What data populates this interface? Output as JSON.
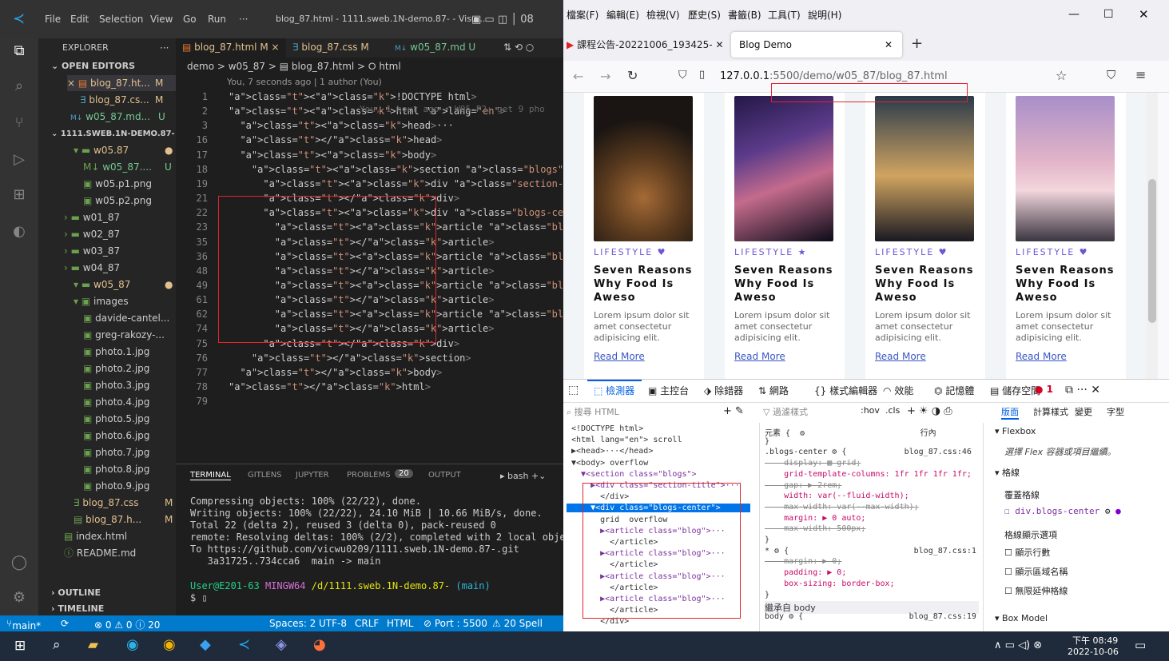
{
  "vscode": {
    "title": "blog_87.html - 1111.sweb.1N-demo.87- - Visu...",
    "menu": [
      "File",
      "Edit",
      "Selection",
      "View",
      "Go",
      "Run",
      "···"
    ],
    "explorer_label": "EXPLORER",
    "open_editors_label": "OPEN EDITORS",
    "open_editors": [
      {
        "name": "blog_87.ht...",
        "status": "M"
      },
      {
        "name": "blog_87.cs...",
        "status": "M"
      },
      {
        "name": "w05_87.md...",
        "status": "U"
      }
    ],
    "repo_label": "1111.SWEB.1N-DEMO.87-",
    "tree": [
      {
        "name": "w05.87",
        "status": "●"
      },
      {
        "name": "w05_87....",
        "status": "U"
      },
      {
        "name": "w05.p1.png",
        "status": ""
      },
      {
        "name": "w05.p2.png",
        "status": ""
      },
      {
        "name": "w01_87",
        "status": ""
      },
      {
        "name": "w02_87",
        "status": ""
      },
      {
        "name": "w03_87",
        "status": ""
      },
      {
        "name": "w04_87",
        "status": ""
      },
      {
        "name": "w05_87",
        "status": "●"
      },
      {
        "name": "images",
        "status": ""
      },
      {
        "name": "davide-cantel...",
        "status": ""
      },
      {
        "name": "greg-rakozy-...",
        "status": ""
      },
      {
        "name": "photo.1.jpg",
        "status": ""
      },
      {
        "name": "photo.2.jpg",
        "status": ""
      },
      {
        "name": "photo.3.jpg",
        "status": ""
      },
      {
        "name": "photo.4.jpg",
        "status": ""
      },
      {
        "name": "photo.5.jpg",
        "status": ""
      },
      {
        "name": "photo.6.jpg",
        "status": ""
      },
      {
        "name": "photo.7.jpg",
        "status": ""
      },
      {
        "name": "photo.8.jpg",
        "status": ""
      },
      {
        "name": "photo.9.jpg",
        "status": ""
      },
      {
        "name": "blog_87.css",
        "status": "M"
      },
      {
        "name": "blog_87.h...",
        "status": "M"
      },
      {
        "name": "index.html",
        "status": ""
      },
      {
        "name": "README.md",
        "status": ""
      }
    ],
    "outline_label": "OUTLINE",
    "timeline_label": "TIMELINE",
    "tabs": [
      {
        "label": "blog_87.html M ×"
      },
      {
        "label": "blog_87.css M"
      },
      {
        "label": "w05_87.md U"
      }
    ],
    "breadcrumb": "demo > w05_87 > ▤ blog_87.html > ⭘ html",
    "blame": "You, 7 seconds ago | 1 author (You)",
    "inline_blame": "You, 1 hour ago • W05-P2: get 9 pho",
    "code_lines": [
      {
        "n": "1",
        "text": "<!DOCTYPE html>"
      },
      {
        "n": "2",
        "text": "<html lang=\"en\">"
      },
      {
        "n": "3",
        "text": "  <head>···"
      },
      {
        "n": "16",
        "text": "  </head>"
      },
      {
        "n": "17",
        "text": "  <body>"
      },
      {
        "n": "18",
        "text": "    <section class=\"blogs\">"
      },
      {
        "n": "19",
        "text": "      <div class=\"section-title\">···"
      },
      {
        "n": "21",
        "text": "      </div>"
      },
      {
        "n": "22",
        "text": "      <div class=\"blogs-center\">"
      },
      {
        "n": "23",
        "text": "        <article class=\"blog\">···"
      },
      {
        "n": "35",
        "text": "        </article>"
      },
      {
        "n": "36",
        "text": "        <article class=\"blog\">···"
      },
      {
        "n": "48",
        "text": "        </article>"
      },
      {
        "n": "49",
        "text": "        <article class=\"blog\">···"
      },
      {
        "n": "61",
        "text": "        </article>"
      },
      {
        "n": "62",
        "text": "        <article class=\"blog\">···"
      },
      {
        "n": "74",
        "text": "        </article>"
      },
      {
        "n": "75",
        "text": "      </div>"
      },
      {
        "n": "76",
        "text": "    </section>"
      },
      {
        "n": "77",
        "text": "  </body>"
      },
      {
        "n": "78",
        "text": "</html>"
      },
      {
        "n": "79",
        "text": ""
      }
    ],
    "panel_tabs": [
      "TERMINAL",
      "GITLENS",
      "JUPYTER",
      "PROBLEMS",
      "OUTPUT"
    ],
    "problems_count": "20",
    "shell": "bash",
    "terminal_lines": [
      "Compressing objects: 100% (22/22), done.",
      "Writing objects: 100% (22/22), 24.10 MiB | 10.66 MiB/s, done.",
      "Total 22 (delta 2), reused 3 (delta 0), pack-reused 0",
      "remote: Resolving deltas: 100% (2/2), completed with 2 local objects",
      "To https://github.com/vicwu0209/1111.sweb.1N-demo.87-.git",
      "   3a31725..734cca6  main -> main",
      ""
    ],
    "prompt_user": "User@E201-63",
    "prompt_shell": "MINGW64",
    "prompt_path": "/d/1111.sweb.1N-demo.87-",
    "prompt_branch": "(main)",
    "prompt_symbol": "$ ",
    "status": {
      "branch": "main*",
      "problems": "⊗ 0 ⚠ 0 ⓘ 20",
      "spaces": "Spaces: 2",
      "encoding": "UTF-8",
      "eol": "CRLF",
      "lang": "HTML",
      "port": "⊘ Port : 5500",
      "spell": "⚠ 20 Spell"
    }
  },
  "firefox": {
    "menu": [
      "檔案(F)",
      "編輯(E)",
      "檢視(V)",
      "歷史(S)",
      "書籤(B)",
      "工具(T)",
      "說明(H)"
    ],
    "tabs": [
      {
        "label": "課程公告-20221006_193425-"
      },
      {
        "label": "Blog Demo"
      }
    ],
    "url_host": "127.0.0.1",
    "url_rest": ":5500/demo/w05_87/blog_87.html",
    "cards": [
      {
        "category": "LIFESTYLE",
        "icon": "heart",
        "title": "Seven Reasons Why Food Is Aweso",
        "text": "Lorem ipsum dolor sit amet consectetur adipisicing elit.",
        "link": "Read More"
      },
      {
        "category": "LIFESTYLE",
        "icon": "star",
        "title": "Seven Reasons Why Food Is Aweso",
        "text": "Lorem ipsum dolor sit amet consectetur adipisicing elit.",
        "link": "Read More"
      },
      {
        "category": "LIFESTYLE",
        "icon": "heart",
        "title": "Seven Reasons Why Food Is Aweso",
        "text": "Lorem ipsum dolor sit amet consectetur adipisicing elit.",
        "link": "Read More"
      },
      {
        "category": "LIFESTYLE",
        "icon": "heart",
        "title": "Seven Reasons Why Food Is Aweso",
        "text": "Lorem ipsum dolor sit amet consectetur adipisicing elit.",
        "link": "Read More"
      }
    ],
    "devtools": {
      "tabs": [
        "檢測器",
        "主控台",
        "除錯器",
        "網路",
        "樣式編輯器",
        "效能",
        "記憶體",
        "儲存空間"
      ],
      "error_count": "1",
      "search_placeholder": "搜尋 HTML",
      "filter_placeholder": "過濾樣式",
      "hov": ":hov",
      "cls": ".cls",
      "layout_tabs": [
        "版面",
        "計算樣式",
        "變更",
        "字型"
      ],
      "html_lines": [
        "<!DOCTYPE html>",
        "<html lang=\"en\"> scroll",
        "▶<head>···</head>",
        "▼<body> overflow",
        "  ▼<section class=\"blogs\">",
        "    ▶<div class=\"section-title\">···",
        "      </div>",
        "    ▼<div class=\"blogs-center\">",
        "      grid  overflow",
        "      ▶<article class=\"blog\">···",
        "        </article>",
        "      ▶<article class=\"blog\">···",
        "        </article>",
        "      ▶<article class=\"blog\">···",
        "        </article>",
        "      ▶<article class=\"blog\">···",
        "        </article>",
        "      </div>"
      ],
      "css_lines": [
        "元素 {  ⚙                        行內",
        "}",
        ".blogs-center ⚙ {            blog_87.css:46",
        "    display: ▦ grid;",
        "    grid-template-columns: 1fr 1fr 1fr 1fr;",
        "    gap: ▶ 2rem;",
        "    width: var(--fluid-width);",
        "    max-width: var(--max-width);",
        "    margin: ▶ 0 auto;",
        "    max-width: 500px;",
        "}",
        "* ⚙ {                          blog_87.css:1",
        "    margin: ▶ 0;",
        "    padding: ▶ 0;",
        "    box-sizing: border-box;",
        "}",
        "繼承自 body",
        "body ⚙ {                      blog_87.css:19"
      ],
      "layout": {
        "flexbox": "Flexbox",
        "flex_hint": "選擇 Flex 容器或項目繼續。",
        "grid": "格線",
        "overlay": "覆蓋格線",
        "overlay_item": "div.blogs-center",
        "display_settings": "格線顯示選項",
        "options": [
          "顯示行數",
          "顯示區域名稱",
          "無限延伸格線"
        ],
        "box_model": "Box Model"
      }
    }
  },
  "taskbar": {
    "time": "下午 08:49",
    "date": "2022-10-06"
  },
  "colors": {
    "accent": "#007acc",
    "red_box": "#e0262c",
    "purple": "#6b58d6"
  }
}
